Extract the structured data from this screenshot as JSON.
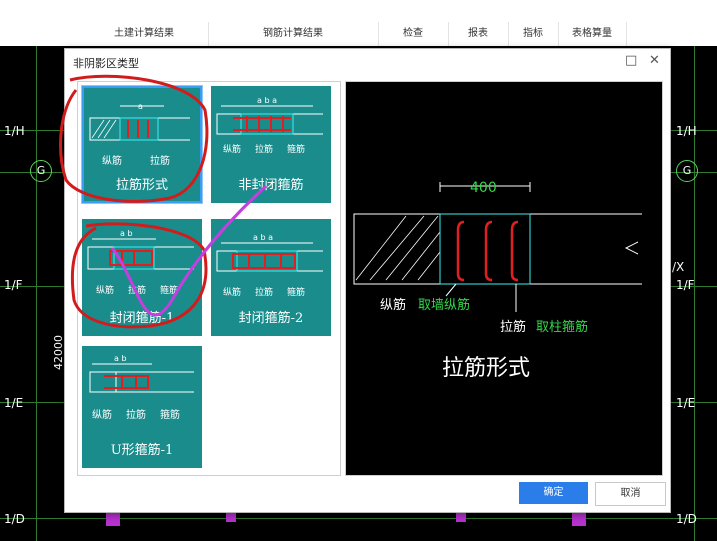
{
  "app": {
    "top_tabs": [
      "土建计算结果",
      "钢筋计算结果",
      "检查",
      "报表",
      "指标",
      "表格算量"
    ],
    "axis_labels_left": [
      "1/H",
      "G",
      "1/F",
      "1/E",
      "1/D"
    ],
    "axis_labels_right": [
      "1/H",
      "G",
      "/X",
      "1/F",
      "1/E",
      "1/D"
    ],
    "dimension_text": "42000",
    "dropdown_caret": "▾"
  },
  "dialog": {
    "title": "非阴影区类型",
    "minimize_glyph": "□",
    "close_glyph": "✕",
    "ok_label": "确定",
    "cancel_label": "取消",
    "tiles": [
      {
        "label": "拉筋形式",
        "selected": true,
        "top_dim": "a",
        "parts": [
          "纵筋",
          "拉筋"
        ]
      },
      {
        "label": "非封闭箍筋",
        "selected": false,
        "top_dim": "a b a",
        "parts": [
          "纵筋",
          "拉筋",
          "箍筋"
        ]
      },
      {
        "label": "封闭箍筋-1",
        "selected": false,
        "top_dim": "a b",
        "parts": [
          "纵筋",
          "拉筋",
          "箍筋"
        ]
      },
      {
        "label": "封闭箍筋-2",
        "selected": false,
        "top_dim": "a b a",
        "parts": [
          "纵筋",
          "拉筋",
          "箍筋"
        ]
      },
      {
        "label": "U形箍筋-1",
        "selected": false,
        "top_dim": "a b",
        "parts": [
          "纵筋",
          "拉筋",
          "箍筋"
        ]
      }
    ],
    "preview": {
      "dimension": "400",
      "label_bar": "纵筋",
      "label_bar_source": "取墙纵筋",
      "label_tie": "拉筋",
      "label_tie_source": "取柱箍筋",
      "caption": "拉筋形式"
    }
  },
  "colors": {
    "tile_bg": "#1b8c8c",
    "ok_blue": "#2b7de9",
    "rebar_red": "#e02020",
    "annotation_red": "#d21c1c",
    "annotation_purple": "#c23fe0",
    "preview_green": "#32d74b"
  }
}
